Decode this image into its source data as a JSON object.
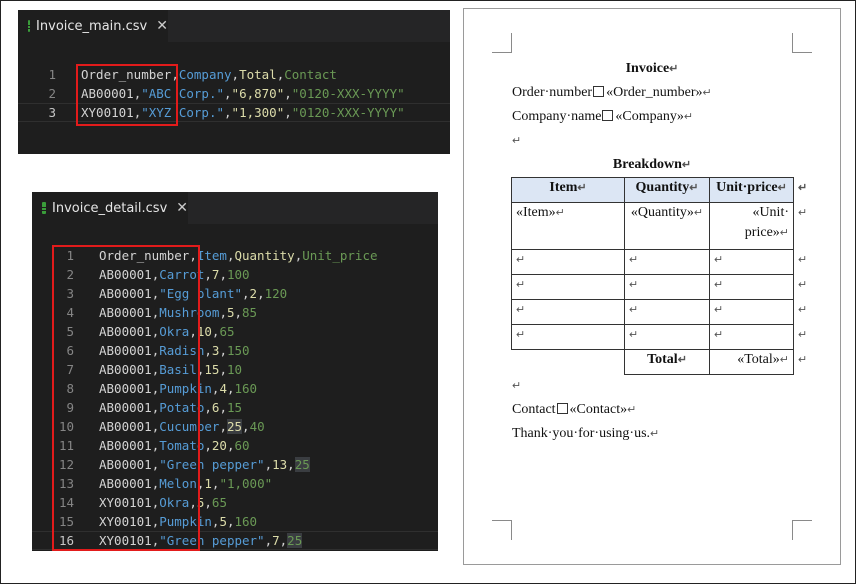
{
  "main_editor": {
    "tab_title": "Invoice_main.csv",
    "lines": [
      {
        "n": "1",
        "parts": [
          [
            "Order_number",
            "c1"
          ],
          [
            ",",
            "c1"
          ],
          [
            "Company",
            "c2"
          ],
          [
            ",",
            "c1"
          ],
          [
            "Total",
            "c3"
          ],
          [
            ",",
            "c1"
          ],
          [
            "Contact",
            "c4"
          ]
        ]
      },
      {
        "n": "2",
        "parts": [
          [
            "AB00001",
            "c1"
          ],
          [
            ",",
            "c1"
          ],
          [
            "\"ABC Corp.\"",
            "c2"
          ],
          [
            ",",
            "c1"
          ],
          [
            "\"6,870\"",
            "c3"
          ],
          [
            ",",
            "c1"
          ],
          [
            "\"0120-XXX-YYYY\"",
            "c4"
          ]
        ]
      },
      {
        "n": "3",
        "parts": [
          [
            "XY00101",
            "c1"
          ],
          [
            ",",
            "c1"
          ],
          [
            "\"XYZ Corp.\"",
            "c2"
          ],
          [
            ",",
            "c1"
          ],
          [
            "\"1,300\"",
            "c3"
          ],
          [
            ",",
            "c1"
          ],
          [
            "\"0120-XXX-YYYY\"",
            "c4"
          ]
        ]
      }
    ]
  },
  "detail_editor": {
    "tab_title": "Invoice_detail.csv",
    "lines": [
      {
        "n": "1",
        "parts": [
          [
            "Order_number",
            "c1"
          ],
          [
            ",",
            "c1"
          ],
          [
            "Item",
            "c2"
          ],
          [
            ",",
            "c1"
          ],
          [
            "Quantity",
            "c3"
          ],
          [
            ",",
            "c1"
          ],
          [
            "Unit_price",
            "c4"
          ]
        ]
      },
      {
        "n": "2",
        "parts": [
          [
            "AB00001",
            "c1"
          ],
          [
            ",",
            "c1"
          ],
          [
            "Carrot",
            "c2"
          ],
          [
            ",",
            "c1"
          ],
          [
            "7",
            "c3"
          ],
          [
            ",",
            "c1"
          ],
          [
            "100",
            "c4"
          ]
        ]
      },
      {
        "n": "3",
        "parts": [
          [
            "AB00001",
            "c1"
          ],
          [
            ",",
            "c1"
          ],
          [
            "\"Egg plant\"",
            "c2"
          ],
          [
            ",",
            "c1"
          ],
          [
            "2",
            "c3"
          ],
          [
            ",",
            "c1"
          ],
          [
            "120",
            "c4"
          ]
        ]
      },
      {
        "n": "4",
        "parts": [
          [
            "AB00001",
            "c1"
          ],
          [
            ",",
            "c1"
          ],
          [
            "Mushroom",
            "c2"
          ],
          [
            ",",
            "c1"
          ],
          [
            "5",
            "c3"
          ],
          [
            ",",
            "c1"
          ],
          [
            "85",
            "c4"
          ]
        ]
      },
      {
        "n": "5",
        "parts": [
          [
            "AB00001",
            "c1"
          ],
          [
            ",",
            "c1"
          ],
          [
            "Okra",
            "c2"
          ],
          [
            ",",
            "c1"
          ],
          [
            "10",
            "c3"
          ],
          [
            ",",
            "c1"
          ],
          [
            "65",
            "c4"
          ]
        ]
      },
      {
        "n": "6",
        "parts": [
          [
            "AB00001",
            "c1"
          ],
          [
            ",",
            "c1"
          ],
          [
            "Radish",
            "c2"
          ],
          [
            ",",
            "c1"
          ],
          [
            "3",
            "c3"
          ],
          [
            ",",
            "c1"
          ],
          [
            "150",
            "c4"
          ]
        ]
      },
      {
        "n": "7",
        "parts": [
          [
            "AB00001",
            "c1"
          ],
          [
            ",",
            "c1"
          ],
          [
            "Basil",
            "c2"
          ],
          [
            ",",
            "c1"
          ],
          [
            "15",
            "c3"
          ],
          [
            ",",
            "c1"
          ],
          [
            "10",
            "c4"
          ]
        ]
      },
      {
        "n": "8",
        "parts": [
          [
            "AB00001",
            "c1"
          ],
          [
            ",",
            "c1"
          ],
          [
            "Pumpkin",
            "c2"
          ],
          [
            ",",
            "c1"
          ],
          [
            "4",
            "c3"
          ],
          [
            ",",
            "c1"
          ],
          [
            "160",
            "c4"
          ]
        ]
      },
      {
        "n": "9",
        "parts": [
          [
            "AB00001",
            "c1"
          ],
          [
            ",",
            "c1"
          ],
          [
            "Potato",
            "c2"
          ],
          [
            ",",
            "c1"
          ],
          [
            "6",
            "c3"
          ],
          [
            ",",
            "c1"
          ],
          [
            "15",
            "c4"
          ]
        ]
      },
      {
        "n": "10",
        "parts": [
          [
            "AB00001",
            "c1"
          ],
          [
            ",",
            "c1"
          ],
          [
            "Cucumber",
            "c2"
          ],
          [
            ",",
            "c1"
          ],
          [
            "25",
            "c3hl"
          ],
          [
            ",",
            "c1"
          ],
          [
            "40",
            "c4"
          ]
        ]
      },
      {
        "n": "11",
        "parts": [
          [
            "AB00001",
            "c1"
          ],
          [
            ",",
            "c1"
          ],
          [
            "Tomato",
            "c2"
          ],
          [
            ",",
            "c1"
          ],
          [
            "20",
            "c3"
          ],
          [
            ",",
            "c1"
          ],
          [
            "60",
            "c4"
          ]
        ]
      },
      {
        "n": "12",
        "parts": [
          [
            "AB00001",
            "c1"
          ],
          [
            ",",
            "c1"
          ],
          [
            "\"Green pepper\"",
            "c2"
          ],
          [
            ",",
            "c1"
          ],
          [
            "13",
            "c3"
          ],
          [
            ",",
            "c1"
          ],
          [
            "25",
            "c4hl"
          ]
        ]
      },
      {
        "n": "13",
        "parts": [
          [
            "AB00001",
            "c1"
          ],
          [
            ",",
            "c1"
          ],
          [
            "Melon",
            "c2"
          ],
          [
            ",",
            "c1"
          ],
          [
            "1",
            "c3"
          ],
          [
            ",",
            "c1"
          ],
          [
            "\"1,000\"",
            "c4"
          ]
        ]
      },
      {
        "n": "14",
        "parts": [
          [
            "XY00101",
            "c1"
          ],
          [
            ",",
            "c1"
          ],
          [
            "Okra",
            "c2"
          ],
          [
            ",",
            "c1"
          ],
          [
            "5",
            "c3"
          ],
          [
            ",",
            "c1"
          ],
          [
            "65",
            "c4"
          ]
        ]
      },
      {
        "n": "15",
        "parts": [
          [
            "XY00101",
            "c1"
          ],
          [
            ",",
            "c1"
          ],
          [
            "Pumpkin",
            "c2"
          ],
          [
            ",",
            "c1"
          ],
          [
            "5",
            "c3"
          ],
          [
            ",",
            "c1"
          ],
          [
            "160",
            "c4"
          ]
        ]
      },
      {
        "n": "16",
        "parts": [
          [
            "XY00101",
            "c1"
          ],
          [
            ",",
            "c1"
          ],
          [
            "\"Green pepper\"",
            "c2"
          ],
          [
            ",",
            "c1"
          ],
          [
            "7",
            "c3"
          ],
          [
            ",",
            "c1"
          ],
          [
            "25",
            "c4hl"
          ]
        ]
      }
    ]
  },
  "document": {
    "title": "Invoice",
    "order_label": "Order·number",
    "order_field": "«Order_number»",
    "company_label": "Company·name",
    "company_field": "«Company»",
    "breakdown_title": "Breakdown",
    "table_headers": [
      "Item",
      "Quantity",
      "Unit·price"
    ],
    "field_item": "«Item»",
    "field_quantity": "«Quantity»",
    "field_unit_price_1": "«Unit·",
    "field_unit_price_2": "price»",
    "total_label": "Total",
    "total_field": "«Total»",
    "contact_label": "Contact",
    "contact_field": "«Contact»",
    "thanks": "Thank·you·for·using·us.",
    "return_mark": "↵"
  },
  "colors": {
    "editor_bg": "#1e1e1e",
    "highlight_box": "#e21b1b",
    "table_header_bg": "#dce6f4"
  }
}
